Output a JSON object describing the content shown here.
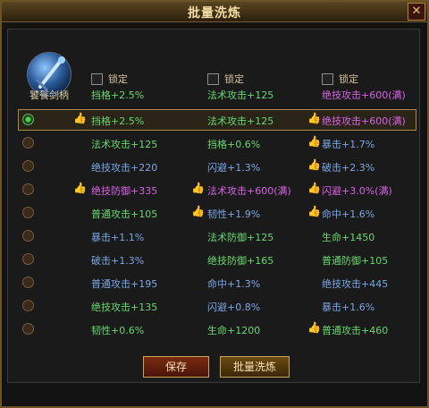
{
  "window": {
    "title": "批量洗炼",
    "close_icon": "close-icon"
  },
  "item": {
    "name": "饕餮剑柄",
    "icon": "sword-hilt-icon"
  },
  "header": {
    "columns": [
      {
        "lock_label": "锁定",
        "value": "挡格+2.5%",
        "color": "green"
      },
      {
        "lock_label": "锁定",
        "value": "法术攻击+125",
        "color": "green"
      },
      {
        "lock_label": "锁定",
        "value": "绝技攻击+600(满)",
        "color": "purple"
      }
    ]
  },
  "rows": [
    {
      "selected": true,
      "cells": [
        {
          "text": "挡格+2.5%",
          "color": "green",
          "thumb": true
        },
        {
          "text": "法术攻击+125",
          "color": "green",
          "thumb": false
        },
        {
          "text": "绝技攻击+600(满)",
          "color": "purple",
          "thumb": true
        }
      ]
    },
    {
      "selected": false,
      "cells": [
        {
          "text": "法术攻击+125",
          "color": "green",
          "thumb": false
        },
        {
          "text": "挡格+0.6%",
          "color": "green",
          "thumb": false
        },
        {
          "text": "暴击+1.7%",
          "color": "blue",
          "thumb": true
        }
      ]
    },
    {
      "selected": false,
      "cells": [
        {
          "text": "绝技攻击+220",
          "color": "blue",
          "thumb": false
        },
        {
          "text": "闪避+1.3%",
          "color": "blue",
          "thumb": false
        },
        {
          "text": "破击+2.3%",
          "color": "blue",
          "thumb": true
        }
      ]
    },
    {
      "selected": false,
      "cells": [
        {
          "text": "绝技防御+335",
          "color": "purple",
          "thumb": true
        },
        {
          "text": "法术攻击+600(满)",
          "color": "purple",
          "thumb": true
        },
        {
          "text": "闪避+3.0%(满)",
          "color": "purple",
          "thumb": true
        }
      ]
    },
    {
      "selected": false,
      "cells": [
        {
          "text": "普通攻击+105",
          "color": "green",
          "thumb": false
        },
        {
          "text": "韧性+1.9%",
          "color": "blue",
          "thumb": true
        },
        {
          "text": "命中+1.6%",
          "color": "blue",
          "thumb": true
        }
      ]
    },
    {
      "selected": false,
      "cells": [
        {
          "text": "暴击+1.1%",
          "color": "blue",
          "thumb": false
        },
        {
          "text": "法术防御+125",
          "color": "green",
          "thumb": false
        },
        {
          "text": "生命+1450",
          "color": "green",
          "thumb": false
        }
      ]
    },
    {
      "selected": false,
      "cells": [
        {
          "text": "破击+1.3%",
          "color": "blue",
          "thumb": false
        },
        {
          "text": "绝技防御+165",
          "color": "green",
          "thumb": false
        },
        {
          "text": "普通防御+105",
          "color": "green",
          "thumb": false
        }
      ]
    },
    {
      "selected": false,
      "cells": [
        {
          "text": "普通攻击+195",
          "color": "blue",
          "thumb": false
        },
        {
          "text": "命中+1.3%",
          "color": "blue",
          "thumb": false
        },
        {
          "text": "绝技攻击+445",
          "color": "blue",
          "thumb": false
        }
      ]
    },
    {
      "selected": false,
      "cells": [
        {
          "text": "绝技攻击+135",
          "color": "green",
          "thumb": false
        },
        {
          "text": "闪避+0.8%",
          "color": "blue",
          "thumb": false
        },
        {
          "text": "暴击+1.6%",
          "color": "blue",
          "thumb": false
        }
      ]
    },
    {
      "selected": false,
      "cells": [
        {
          "text": "韧性+0.6%",
          "color": "green",
          "thumb": false
        },
        {
          "text": "生命+1200",
          "color": "green",
          "thumb": false
        },
        {
          "text": "普通攻击+460",
          "color": "green",
          "thumb": true
        }
      ]
    }
  ],
  "buttons": {
    "save": "保存",
    "batch_refine": "批量洗炼"
  },
  "colors": {
    "green": "#65d96f",
    "blue": "#79a7e6",
    "purple": "#d862e6",
    "gold": "#c8a55d"
  }
}
